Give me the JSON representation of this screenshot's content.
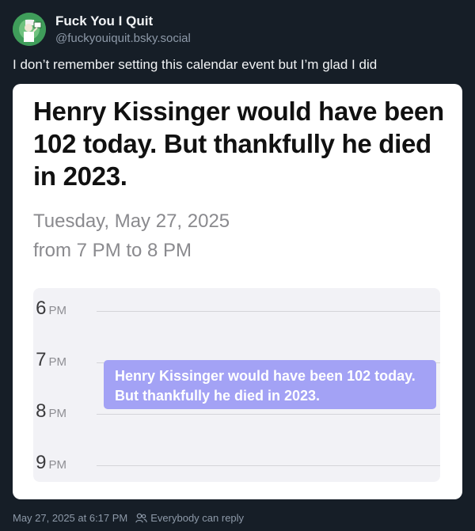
{
  "author": {
    "display_name": "Fuck You I Quit",
    "handle": "@fuckyouiquit.bsky.social",
    "avatar_icon": "avatar-icon"
  },
  "post": {
    "text": "I don’t remember setting this calendar event but I’m glad I did"
  },
  "calendar_event": {
    "title": "Henry Kissinger would have been 102 today. But thankfully he died in 2023.",
    "date": "Tuesday, May 27, 2025",
    "time_range": "from 7 PM to 8 PM",
    "hours": [
      {
        "hour": "6",
        "suffix": "PM"
      },
      {
        "hour": "7",
        "suffix": "PM"
      },
      {
        "hour": "8",
        "suffix": "PM"
      },
      {
        "hour": "9",
        "suffix": "PM"
      }
    ],
    "block_text": "Henry Kissinger would have been 102 today. But thankfully he died in 2023.",
    "block_color": "#a3a2f5"
  },
  "footer": {
    "timestamp": "May 27, 2025 at 6:17 PM",
    "reply_setting": "Everybody can reply",
    "reply_icon": "people-icon"
  },
  "colors": {
    "background": "#161e27",
    "muted_text": "#8d99a8"
  }
}
